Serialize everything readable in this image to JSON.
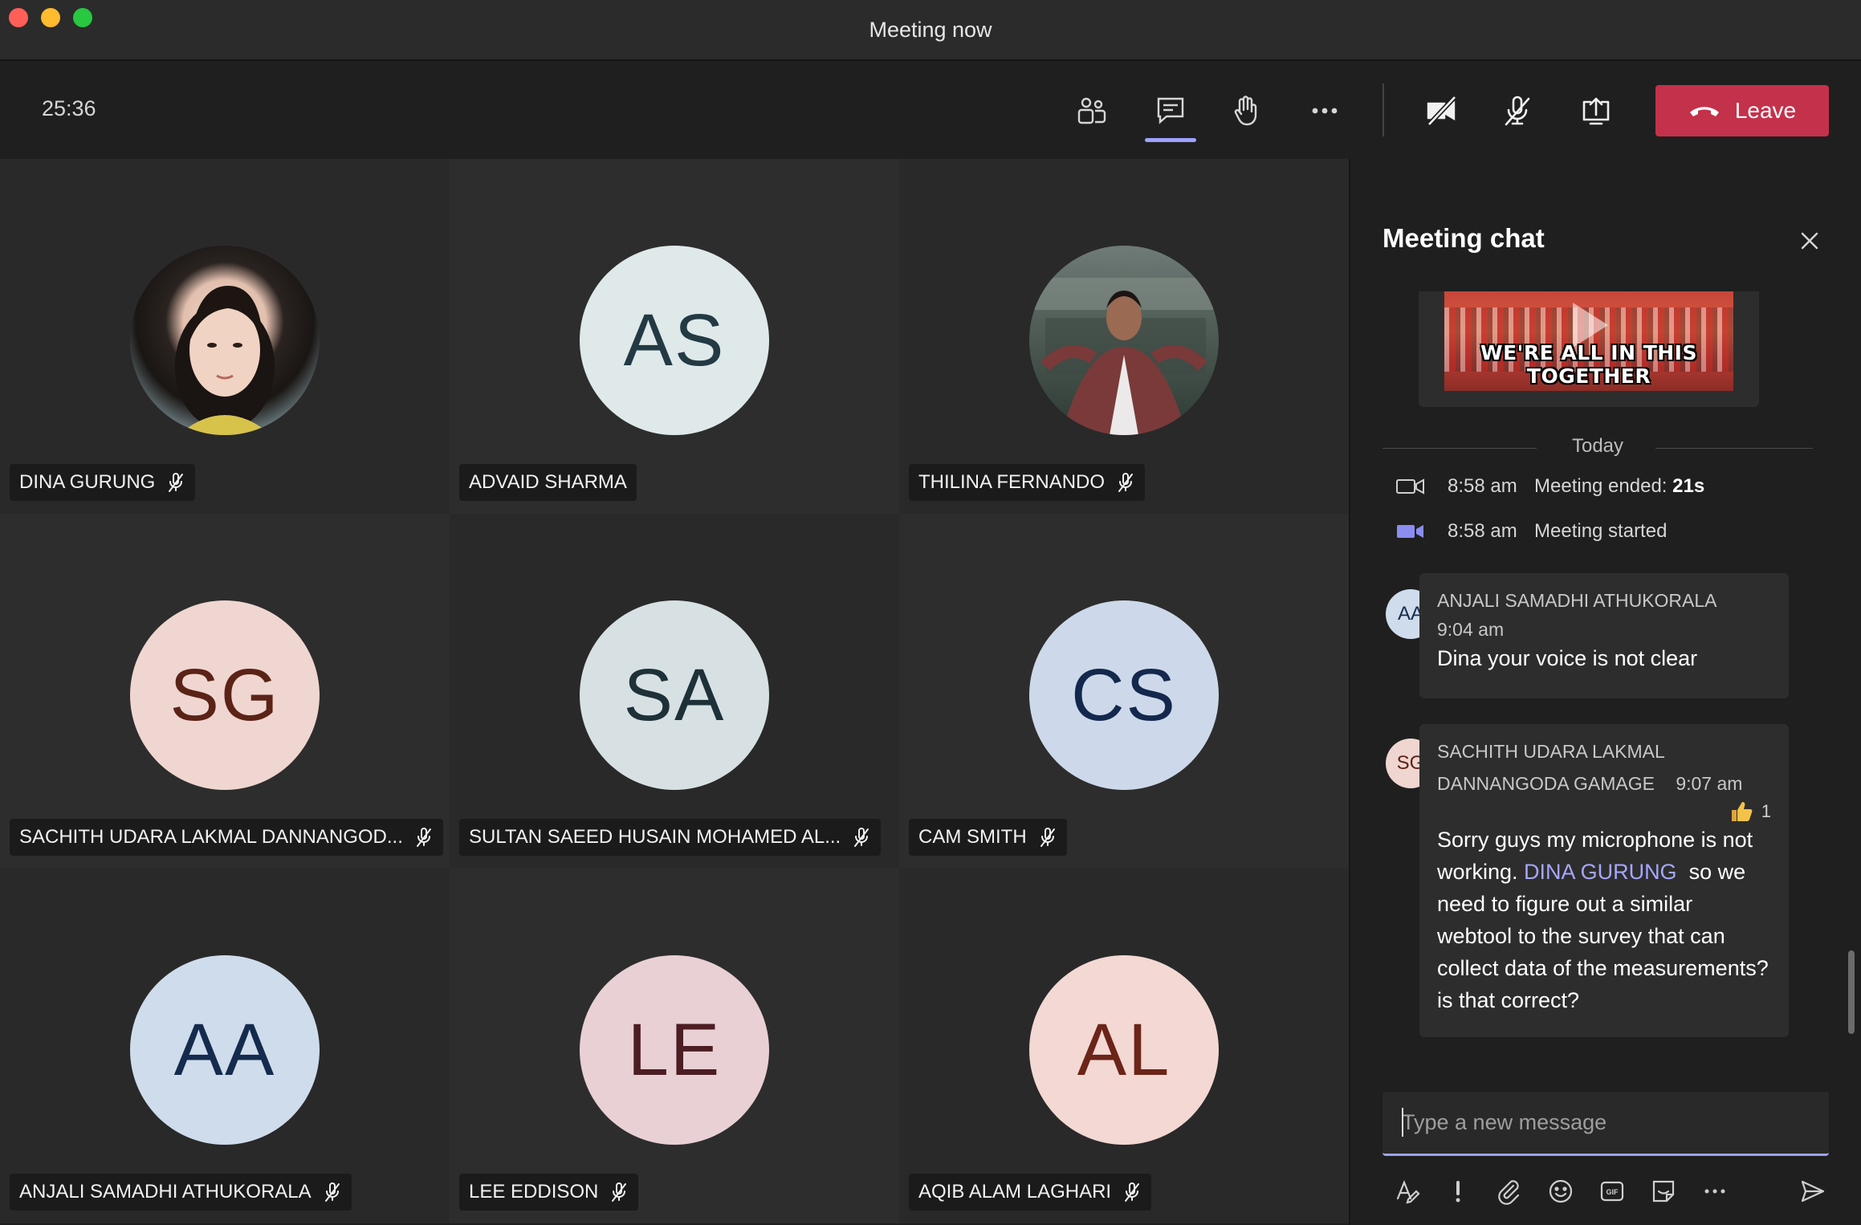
{
  "window": {
    "title": "Meeting now"
  },
  "toolbar": {
    "timer": "25:36",
    "buttons": [
      {
        "name": "participants",
        "icon": "people-icon"
      },
      {
        "name": "chat",
        "icon": "chat-icon",
        "active": true
      },
      {
        "name": "raise-hand",
        "icon": "hand-icon"
      },
      {
        "name": "more-actions",
        "icon": "more-icon"
      },
      {
        "name": "camera",
        "icon": "camera-off-icon"
      },
      {
        "name": "mic",
        "icon": "mic-off-icon"
      },
      {
        "name": "share",
        "icon": "share-screen-icon"
      }
    ],
    "leave_label": "Leave",
    "leave_color": "#c4314b",
    "active_indicator_color": "#9ea2ff"
  },
  "participants": [
    {
      "name": "DINA GURUNG",
      "initials": "",
      "photo": true,
      "muted": true,
      "bg": "#cfcfcf"
    },
    {
      "name": "ADVAID SHARMA",
      "initials": "AS",
      "muted": false,
      "bg": "#dfe9ea",
      "fg": "#233a44"
    },
    {
      "name": "THILINA FERNANDO",
      "initials": "",
      "photo": true,
      "muted": true,
      "bg": "#4a5a52"
    },
    {
      "name": "SACHITH UDARA LAKMAL DANNANGOD...",
      "initials": "SG",
      "muted": true,
      "bg": "#f0d6d0",
      "fg": "#5b2317"
    },
    {
      "name": "SULTAN SAEED HUSAIN MOHAMED AL...",
      "initials": "SA",
      "muted": true,
      "bg": "#d7e1e3",
      "fg": "#1e3038"
    },
    {
      "name": "CAM SMITH",
      "initials": "CS",
      "muted": true,
      "bg": "#cdd9ea",
      "fg": "#14284d"
    },
    {
      "name": "ANJALI SAMADHI ATHUKORALA",
      "initials": "AA",
      "muted": true,
      "bg": "#cfdcec",
      "fg": "#142b4d"
    },
    {
      "name": "LEE EDDISON",
      "initials": "LE",
      "muted": true,
      "bg": "#e9d0d4",
      "fg": "#4c1d23"
    },
    {
      "name": "AQIB ALAM LAGHARI",
      "initials": "AL",
      "muted": true,
      "bg": "#f3d8d3",
      "fg": "#6b2418"
    }
  ],
  "chat": {
    "title": "Meeting chat",
    "gif_caption": "WE'RE ALL IN THIS TOGETHER",
    "divider_label": "Today",
    "events": [
      {
        "time": "8:58 am",
        "text": "Meeting ended: ",
        "bold": "21s",
        "icon": "meeting-ended-icon"
      },
      {
        "time": "8:58 am",
        "text": "Meeting started",
        "bold": "",
        "icon": "meeting-started-icon"
      }
    ],
    "messages": [
      {
        "initials": "AA",
        "avatar_bg": "#cfdcec",
        "avatar_fg": "#142b4d",
        "sender": "ANJALI SAMADHI ATHUKORALA",
        "time": "9:04 am",
        "text": "Dina your voice is not clear"
      },
      {
        "initials": "SG",
        "avatar_bg": "#f0d6d0",
        "avatar_fg": "#5b2317",
        "sender_line1": "SACHITH UDARA LAKMAL",
        "sender_line2": "DANNANGODA GAMAGE",
        "time": "9:07 am",
        "reaction_count": "1",
        "text_before": "Sorry guys my microphone is not working. ",
        "mention": "DINA GURUNG",
        "text_after": "  so we need to figure out a similar webtool to the survey that can collect data of the measurements? is that correct?"
      }
    ],
    "composer_placeholder": "Type a new message",
    "composer_tools": [
      "format-icon",
      "important-icon",
      "attach-icon",
      "emoji-icon",
      "gif-icon",
      "sticker-icon",
      "more-icon",
      "send-icon"
    ]
  }
}
